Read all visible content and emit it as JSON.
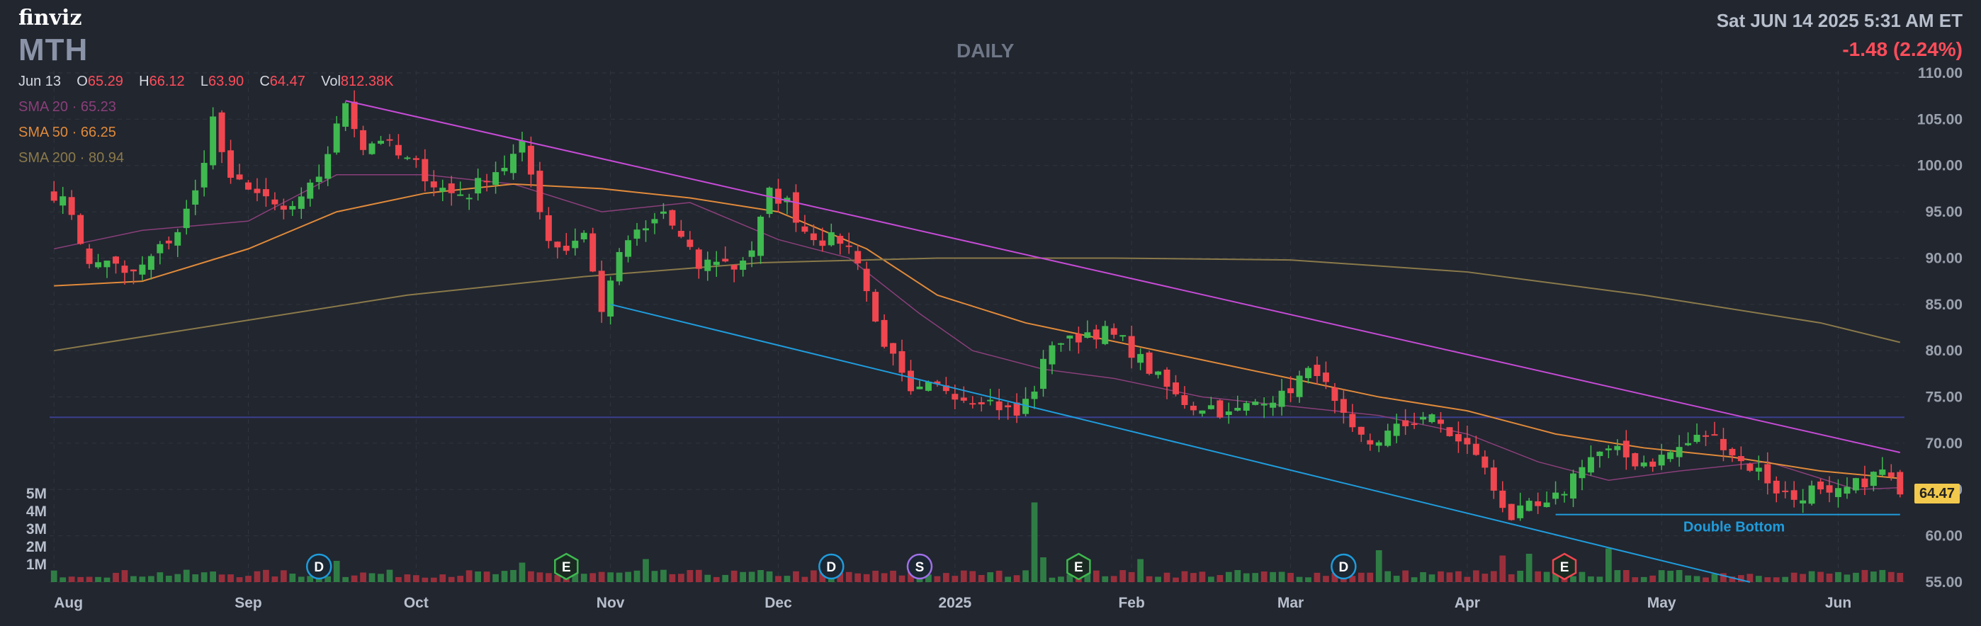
{
  "header": {
    "logo": "finviz",
    "ticker": "MTH",
    "timeframe": "DAILY",
    "datetime": "Sat JUN 14 2025 5:31 AM ET",
    "change": "-1.48 (2.24%)"
  },
  "ohlc": {
    "date": "Jun 13",
    "o_label": "O",
    "o": "65.29",
    "h_label": "H",
    "h": "66.12",
    "l_label": "L",
    "l": "63.90",
    "c_label": "C",
    "c": "64.47",
    "vol_label": "Vol",
    "vol": "812.38K"
  },
  "indicators": {
    "sma20": {
      "label": "SMA 20",
      "value": "65.23",
      "color": "#8a3f7a"
    },
    "sma50": {
      "label": "SMA 50",
      "value": "66.25",
      "color": "#e08a3a"
    },
    "sma200": {
      "label": "SMA 200",
      "value": "80.94",
      "color": "#8a7a4a"
    }
  },
  "colors": {
    "up": "#3fb950",
    "down": "#f0464f",
    "background": "#22262f",
    "upper_trendline": "#c64bd6",
    "lower_trendline": "#1f9cdc",
    "horizontal_line": "#3a3f8f",
    "price_tag": "#f2c94c"
  },
  "last_price": "64.47",
  "chart_data": {
    "type": "candlestick",
    "ylim": [
      55,
      110
    ],
    "y_ticks": [
      "110.00",
      "105.00",
      "100.00",
      "95.00",
      "90.00",
      "85.00",
      "80.00",
      "75.00",
      "70.00",
      "65.00",
      "60.00",
      "55.00"
    ],
    "y_tick_values": [
      110,
      105,
      100,
      95,
      90,
      85,
      80,
      75,
      70,
      65,
      60,
      55
    ],
    "x_ticks": [
      "Aug",
      "Sep",
      "Oct",
      "Nov",
      "Dec",
      "2025",
      "Feb",
      "Mar",
      "Apr",
      "May",
      "Jun"
    ],
    "x_tick_index": [
      0,
      22,
      41,
      63,
      82,
      102,
      122,
      140,
      160,
      182,
      202
    ],
    "volume_ticks": [
      "5M",
      "4M",
      "3M",
      "2M",
      "1M"
    ],
    "volume_tick_values": [
      5,
      4,
      3,
      2,
      1
    ],
    "volume_ylim": [
      0,
      5.4
    ],
    "anchors": [
      [
        0,
        97
      ],
      [
        2,
        95
      ],
      [
        4,
        89
      ],
      [
        6,
        90
      ],
      [
        8,
        88
      ],
      [
        10,
        89
      ],
      [
        12,
        91
      ],
      [
        14,
        93
      ],
      [
        16,
        97
      ],
      [
        18,
        105
      ],
      [
        20,
        98
      ],
      [
        22,
        98
      ],
      [
        24,
        96
      ],
      [
        26,
        95
      ],
      [
        28,
        96
      ],
      [
        30,
        99
      ],
      [
        32,
        104
      ],
      [
        33,
        107
      ],
      [
        35,
        102
      ],
      [
        37,
        103
      ],
      [
        39,
        101
      ],
      [
        41,
        100
      ],
      [
        43,
        98
      ],
      [
        45,
        97
      ],
      [
        47,
        97
      ],
      [
        49,
        99
      ],
      [
        51,
        100
      ],
      [
        53,
        102
      ],
      [
        54,
        99
      ],
      [
        56,
        92
      ],
      [
        58,
        91
      ],
      [
        60,
        93
      ],
      [
        62,
        84
      ],
      [
        63,
        88
      ],
      [
        65,
        92
      ],
      [
        67,
        93
      ],
      [
        69,
        95
      ],
      [
        71,
        92
      ],
      [
        73,
        89
      ],
      [
        75,
        90
      ],
      [
        77,
        89
      ],
      [
        79,
        91
      ],
      [
        81,
        97
      ],
      [
        83,
        96
      ],
      [
        85,
        93
      ],
      [
        87,
        92
      ],
      [
        89,
        92
      ],
      [
        91,
        90
      ],
      [
        93,
        83
      ],
      [
        95,
        79
      ],
      [
        97,
        75
      ],
      [
        99,
        76
      ],
      [
        101,
        76
      ],
      [
        103,
        75
      ],
      [
        105,
        75
      ],
      [
        107,
        74
      ],
      [
        109,
        73
      ],
      [
        111,
        76
      ],
      [
        113,
        81
      ],
      [
        115,
        81
      ],
      [
        117,
        82
      ],
      [
        119,
        82
      ],
      [
        121,
        81
      ],
      [
        123,
        79
      ],
      [
        125,
        77
      ],
      [
        127,
        75
      ],
      [
        129,
        74
      ],
      [
        131,
        74
      ],
      [
        133,
        73
      ],
      [
        135,
        74
      ],
      [
        137,
        75
      ],
      [
        139,
        75
      ],
      [
        141,
        77
      ],
      [
        143,
        78
      ],
      [
        145,
        74
      ],
      [
        147,
        71
      ],
      [
        149,
        70
      ],
      [
        151,
        71
      ],
      [
        153,
        72
      ],
      [
        155,
        73
      ],
      [
        157,
        72
      ],
      [
        159,
        70
      ],
      [
        161,
        69
      ],
      [
        163,
        65
      ],
      [
        165,
        62
      ],
      [
        167,
        63
      ],
      [
        169,
        63
      ],
      [
        171,
        65
      ],
      [
        173,
        68
      ],
      [
        175,
        69
      ],
      [
        177,
        69
      ],
      [
        179,
        68
      ],
      [
        181,
        68
      ],
      [
        183,
        69
      ],
      [
        185,
        70
      ],
      [
        187,
        71
      ],
      [
        189,
        70
      ],
      [
        191,
        68
      ],
      [
        193,
        67
      ],
      [
        195,
        65
      ],
      [
        197,
        64
      ],
      [
        199,
        65
      ],
      [
        201,
        64
      ],
      [
        203,
        65
      ],
      [
        205,
        66
      ],
      [
        207,
        67
      ],
      [
        208,
        66
      ],
      [
        209,
        64.47
      ]
    ],
    "volume_spikes": [
      [
        32,
        1.2
      ],
      [
        53,
        1.1
      ],
      [
        67,
        1.3
      ],
      [
        88,
        1.0
      ],
      [
        111,
        4.5
      ],
      [
        112,
        1.4
      ],
      [
        123,
        1.3
      ],
      [
        150,
        1.8
      ],
      [
        164,
        1.5
      ],
      [
        167,
        1.6
      ],
      [
        176,
        1.9
      ]
    ],
    "sma_points": {
      "sma20": [
        [
          0,
          91
        ],
        [
          10,
          93
        ],
        [
          22,
          94
        ],
        [
          32,
          99
        ],
        [
          42,
          99
        ],
        [
          52,
          98
        ],
        [
          62,
          95
        ],
        [
          72,
          96
        ],
        [
          82,
          92
        ],
        [
          90,
          90
        ],
        [
          98,
          84
        ],
        [
          104,
          80
        ],
        [
          112,
          78
        ],
        [
          120,
          77
        ],
        [
          130,
          75
        ],
        [
          140,
          74
        ],
        [
          150,
          73
        ],
        [
          160,
          71
        ],
        [
          168,
          68
        ],
        [
          176,
          66
        ],
        [
          184,
          67
        ],
        [
          194,
          68
        ],
        [
          204,
          65
        ],
        [
          209,
          65.2
        ]
      ],
      "sma50": [
        [
          0,
          87
        ],
        [
          10,
          87.5
        ],
        [
          22,
          91
        ],
        [
          32,
          95
        ],
        [
          42,
          97
        ],
        [
          52,
          98
        ],
        [
          62,
          97.5
        ],
        [
          72,
          96.5
        ],
        [
          82,
          95
        ],
        [
          92,
          91
        ],
        [
          100,
          86
        ],
        [
          110,
          83
        ],
        [
          120,
          81
        ],
        [
          130,
          79
        ],
        [
          140,
          77
        ],
        [
          150,
          75
        ],
        [
          160,
          73.5
        ],
        [
          170,
          71
        ],
        [
          180,
          69.5
        ],
        [
          190,
          68.5
        ],
        [
          200,
          67
        ],
        [
          209,
          66.2
        ]
      ],
      "sma200": [
        [
          0,
          80
        ],
        [
          20,
          83
        ],
        [
          40,
          86
        ],
        [
          60,
          88
        ],
        [
          80,
          89.5
        ],
        [
          100,
          90
        ],
        [
          120,
          90
        ],
        [
          140,
          89.8
        ],
        [
          160,
          88.5
        ],
        [
          180,
          86
        ],
        [
          200,
          83
        ],
        [
          209,
          80.9
        ]
      ]
    },
    "trendlines": [
      {
        "name": "upper",
        "points": [
          [
            33,
            107
          ],
          [
            209,
            69
          ]
        ]
      },
      {
        "name": "lower",
        "points": [
          [
            63,
            85
          ],
          [
            192,
            55
          ]
        ]
      }
    ],
    "horizontal_lines": [
      {
        "name": "resistance",
        "price": 72.8
      },
      {
        "name": "double-bottom",
        "price": 62.3,
        "from_index": 170,
        "to_index": 209
      }
    ],
    "annotations": [
      {
        "text": "Double Bottom",
        "index": 185,
        "price": 61
      }
    ],
    "event_markers": [
      {
        "label": "D",
        "index": 30,
        "color": "#1f9cdc"
      },
      {
        "label": "E",
        "index": 58,
        "color": "#3fb950"
      },
      {
        "label": "D",
        "index": 88,
        "color": "#1f9cdc"
      },
      {
        "label": "S",
        "index": 98,
        "color": "#a070e8"
      },
      {
        "label": "E",
        "index": 116,
        "color": "#3fb950"
      },
      {
        "label": "D",
        "index": 146,
        "color": "#1f9cdc"
      },
      {
        "label": "E",
        "index": 171,
        "color": "#f0464f"
      }
    ]
  }
}
